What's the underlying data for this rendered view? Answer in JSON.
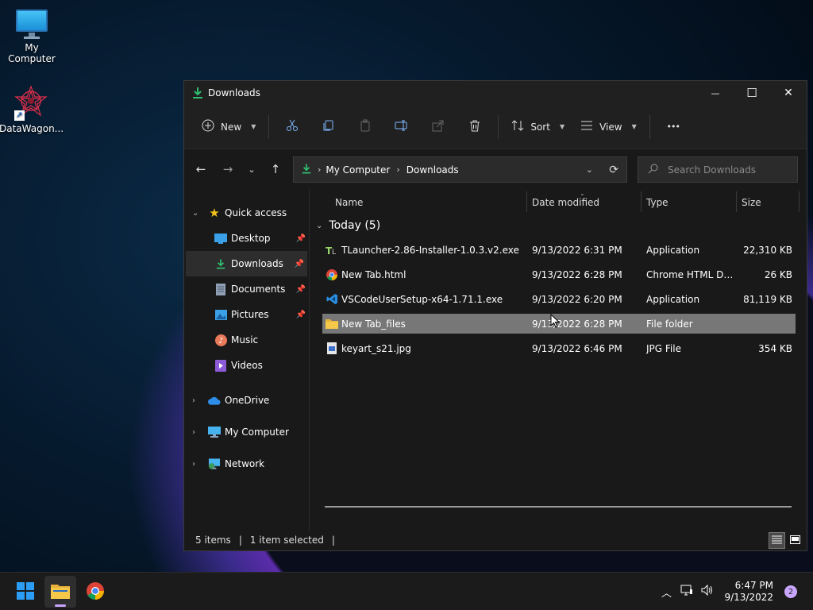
{
  "desktop": {
    "icons": [
      {
        "label": "My Computer",
        "icon": "monitor-icon"
      },
      {
        "label": "DataWagon...",
        "icon": "datawagon-icon"
      }
    ]
  },
  "window": {
    "title": "Downloads",
    "controls": {
      "minimize": "—",
      "maximize": "☐",
      "close": "✕"
    }
  },
  "toolbar": {
    "new_label": "New",
    "sort_label": "Sort",
    "view_label": "View",
    "more_label": "•••"
  },
  "address": {
    "segments": [
      "My Computer",
      "Downloads"
    ],
    "search_placeholder": "Search Downloads"
  },
  "sidebar": {
    "quick_access": "Quick access",
    "items": [
      {
        "label": "Desktop",
        "icon": "desktop-icon",
        "pinned": true
      },
      {
        "label": "Downloads",
        "icon": "download-icon",
        "pinned": true,
        "selected": true
      },
      {
        "label": "Documents",
        "icon": "document-icon",
        "pinned": true
      },
      {
        "label": "Pictures",
        "icon": "pictures-icon",
        "pinned": true
      },
      {
        "label": "Music",
        "icon": "music-icon",
        "pinned": false
      },
      {
        "label": "Videos",
        "icon": "videos-icon",
        "pinned": false
      }
    ],
    "roots": [
      {
        "label": "OneDrive",
        "icon": "cloud-icon"
      },
      {
        "label": "My Computer",
        "icon": "computer-icon"
      },
      {
        "label": "Network",
        "icon": "network-icon"
      }
    ]
  },
  "columns": {
    "name": "Name",
    "date": "Date modified",
    "type": "Type",
    "size": "Size"
  },
  "group": {
    "label": "Today (5)"
  },
  "files": [
    {
      "name": "TLauncher-2.86-Installer-1.0.3.v2.exe",
      "date": "9/13/2022 6:31 PM",
      "type": "Application",
      "size": "22,310 KB",
      "icon": "tlauncher-icon"
    },
    {
      "name": "New Tab.html",
      "date": "9/13/2022 6:28 PM",
      "type": "Chrome HTML Do...",
      "size": "26 KB",
      "icon": "chrome-icon"
    },
    {
      "name": "VSCodeUserSetup-x64-1.71.1.exe",
      "date": "9/13/2022 6:20 PM",
      "type": "Application",
      "size": "81,119 KB",
      "icon": "vscode-icon"
    },
    {
      "name": "New Tab_files",
      "date": "9/13/2022 6:28 PM",
      "type": "File folder",
      "size": "",
      "icon": "folder-icon",
      "selected": true
    },
    {
      "name": "keyart_s21.jpg",
      "date": "9/13/2022 6:46 PM",
      "type": "JPG File",
      "size": "354 KB",
      "icon": "image-file-icon"
    }
  ],
  "status": {
    "items": "5 items",
    "selected": "1 item selected"
  },
  "taskbar": {
    "clock_time": "6:47 PM",
    "clock_date": "9/13/2022",
    "notifications": "2"
  },
  "colors": {
    "accent": "#60cdff",
    "selection": "#777777",
    "window_bg": "#191919",
    "download_green": "#2fbf71"
  }
}
